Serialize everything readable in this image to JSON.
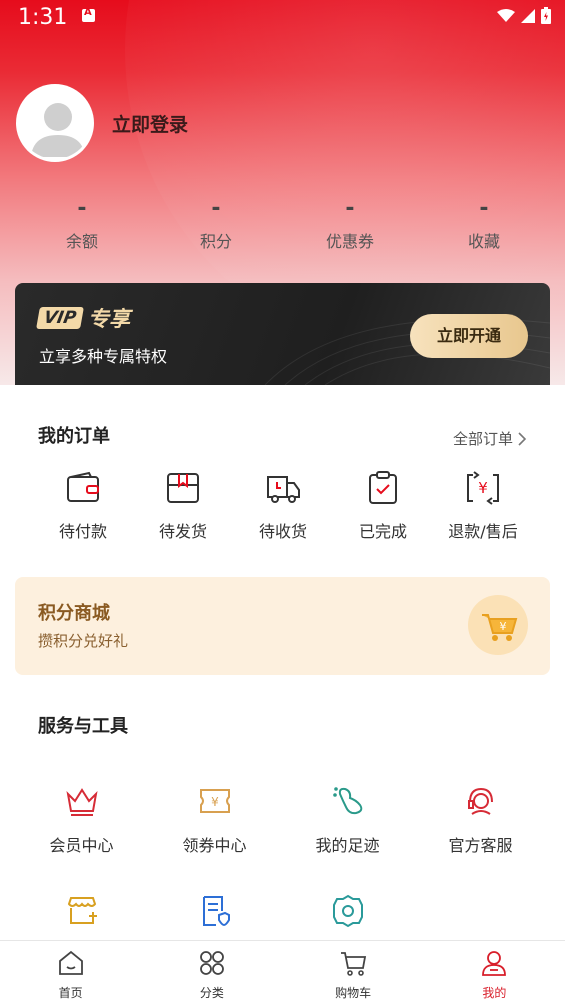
{
  "status": {
    "time": "1:31"
  },
  "profile": {
    "login_label": "立即登录"
  },
  "stats": [
    {
      "value": "-",
      "label": "余额"
    },
    {
      "value": "-",
      "label": "积分"
    },
    {
      "value": "-",
      "label": "优惠券"
    },
    {
      "value": "-",
      "label": "收藏"
    }
  ],
  "vip": {
    "badge": "VIP",
    "title": "专享",
    "subtitle": "立享多种专属特权",
    "button": "立即开通"
  },
  "orders": {
    "title": "我的订单",
    "all_label": "全部订单",
    "items": [
      {
        "label": "待付款",
        "icon": "wallet-icon"
      },
      {
        "label": "待发货",
        "icon": "package-icon"
      },
      {
        "label": "待收货",
        "icon": "truck-icon"
      },
      {
        "label": "已完成",
        "icon": "clipboard-check-icon"
      },
      {
        "label": "退款/售后",
        "icon": "refund-icon"
      }
    ]
  },
  "points_mall": {
    "title": "积分商城",
    "subtitle": "攒积分兑好礼",
    "icon": "cart-icon"
  },
  "tools": {
    "title": "服务与工具",
    "items": [
      {
        "label": "会员中心",
        "icon": "crown-icon"
      },
      {
        "label": "领券中心",
        "icon": "coupon-icon"
      },
      {
        "label": "我的足迹",
        "icon": "footprint-icon"
      },
      {
        "label": "官方客服",
        "icon": "headset-icon"
      },
      {
        "label": "",
        "icon": "store-icon"
      },
      {
        "label": "",
        "icon": "document-icon"
      },
      {
        "label": "",
        "icon": "settings-icon"
      }
    ]
  },
  "tabbar": {
    "items": [
      {
        "label": "首页",
        "icon": "home-icon"
      },
      {
        "label": "分类",
        "icon": "category-icon"
      },
      {
        "label": "购物车",
        "icon": "cart-icon"
      },
      {
        "label": "我的",
        "icon": "user-icon"
      }
    ],
    "active_index": 3
  },
  "colors": {
    "primary": "#e60c1c",
    "active_tab": "#d81e2a",
    "gold": "#f3d9a8"
  }
}
